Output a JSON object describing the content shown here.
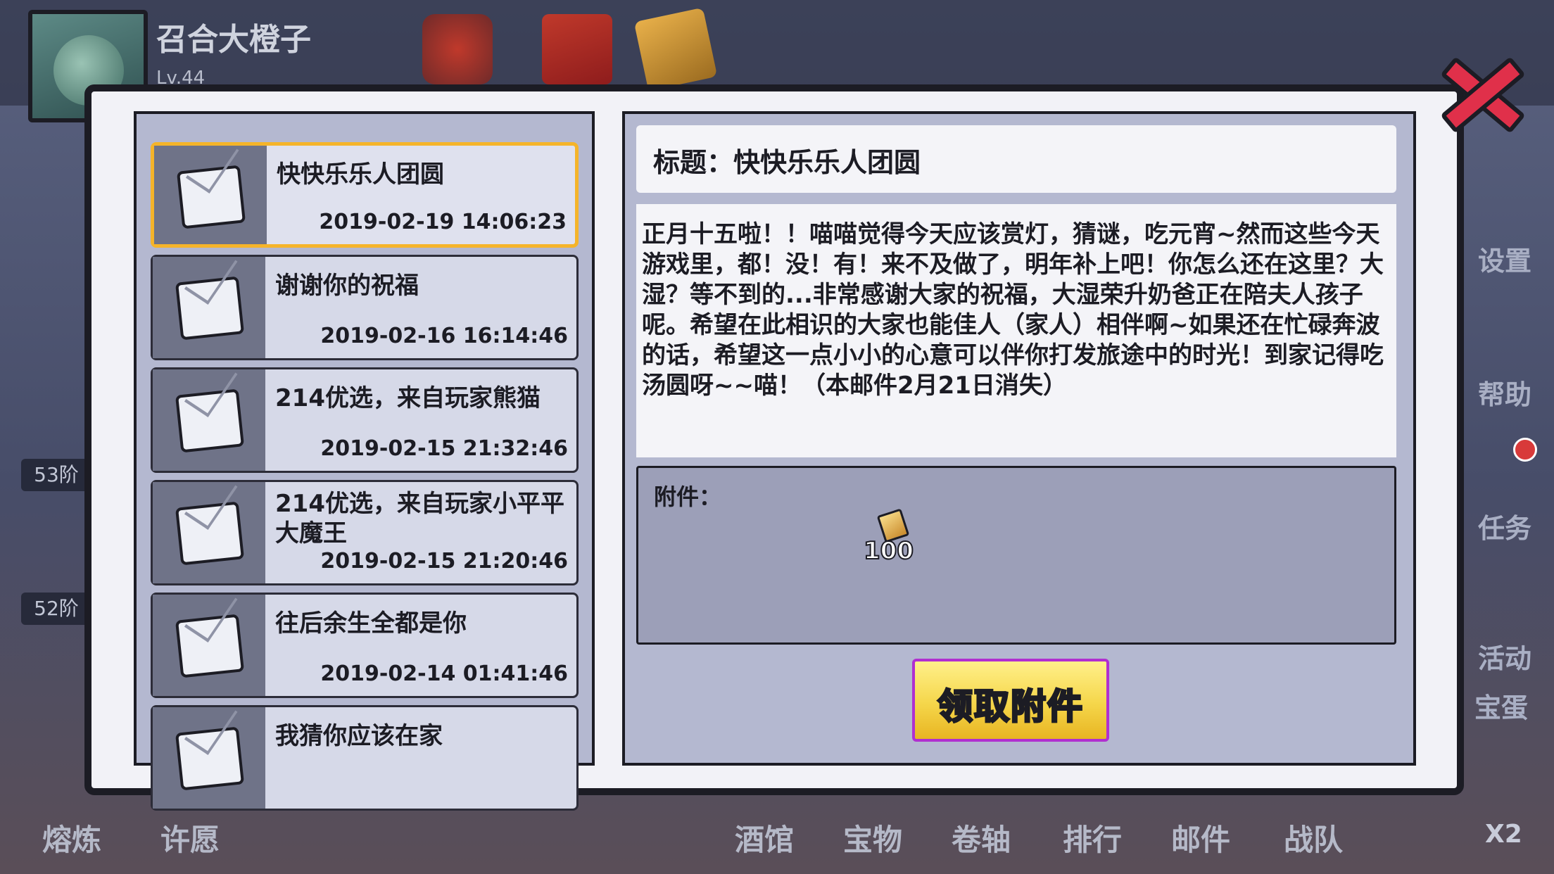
{
  "player": {
    "name": "召合大橙子",
    "level": "Lv.44"
  },
  "side_labels": [
    "设置",
    "帮助",
    "任务",
    "活动",
    "宝蛋"
  ],
  "left_badges": [
    "53阶",
    "52阶"
  ],
  "bottom_bar": [
    "熔炼",
    "许愿",
    "酒馆",
    "宝物",
    "卷轴",
    "排行",
    "邮件",
    "战队"
  ],
  "speed": "X2",
  "mail_list": [
    {
      "title": "快快乐乐人团圆",
      "date": "2019-02-19 14:06:23",
      "selected": true
    },
    {
      "title": "谢谢你的祝福",
      "date": "2019-02-16 16:14:46"
    },
    {
      "title": "214优选，来自玩家熊猫",
      "date": "2019-02-15 21:32:46"
    },
    {
      "title": "214优选，来自玩家小平平大魔王",
      "date": "2019-02-15 21:20:46"
    },
    {
      "title": "往后余生全都是你",
      "date": "2019-02-14 01:41:46"
    },
    {
      "title": "我猜你应该在家",
      "date": ""
    }
  ],
  "detail": {
    "title_label": "标题：快快乐乐人团圆",
    "body": "正月十五啦！！喵喵觉得今天应该赏灯，猜谜，吃元宵~然而这些今天游戏里，都！没！有！来不及做了，明年补上吧！你怎么还在这里？大湿？等不到的...非常感谢大家的祝福，大湿荣升奶爸正在陪夫人孩子呢。希望在此相识的大家也能佳人（家人）相伴啊~如果还在忙碌奔波的话，希望这一点小小的心意可以伴你打发旅途中的时光！到家记得吃汤圆呀~~喵！（本邮件2月21日消失）",
    "attachment_label": "附件：",
    "attachment_count": "100",
    "attachment_icon": "gem-icon",
    "claim_button": "领取附件"
  }
}
